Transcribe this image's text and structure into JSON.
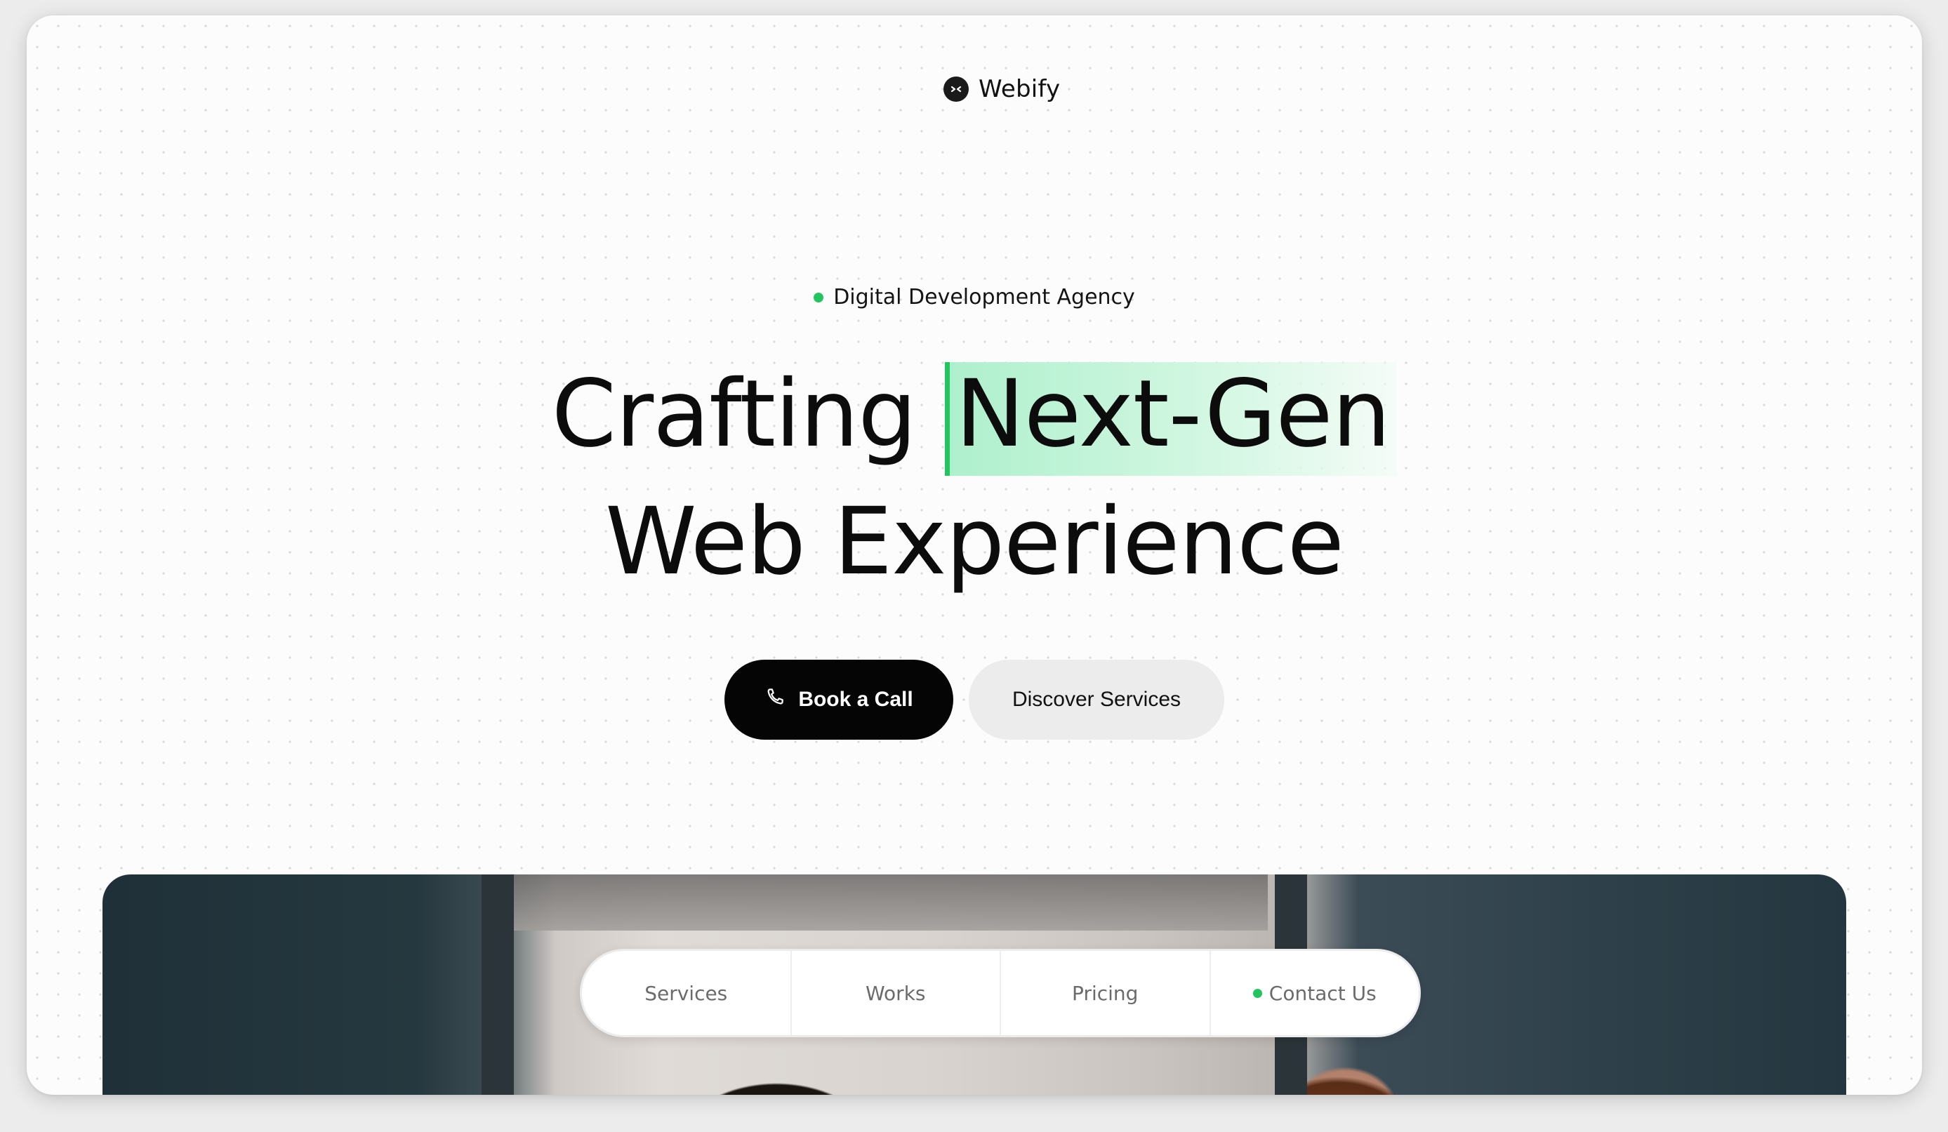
{
  "brand": {
    "name": "Webify",
    "logo_icon": "webify-logo-icon"
  },
  "hero": {
    "eyebrow": "Digital Development Agency",
    "eyebrow_dot_color": "#22c55e",
    "headline_part1": "Crafting",
    "headline_highlight": "Next-Gen",
    "headline_line2": "Web Experience",
    "highlight_color": "#aef0cd",
    "accent_color": "#22c55e"
  },
  "actions": {
    "primary_label": "Book a Call",
    "primary_icon": "phone-icon",
    "secondary_label": "Discover Services"
  },
  "nav": {
    "items": [
      {
        "label": "Services"
      },
      {
        "label": "Works"
      },
      {
        "label": "Pricing"
      },
      {
        "label": "Contact Us",
        "indicator_color": "#22c55e"
      }
    ]
  }
}
